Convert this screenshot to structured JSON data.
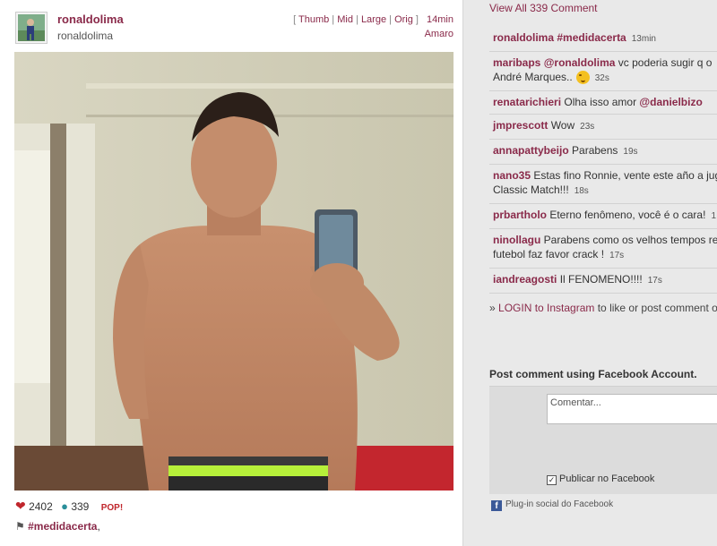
{
  "post": {
    "username": "ronaldolima",
    "fullname": "ronaldolima",
    "sizes": [
      "Thumb",
      "Mid",
      "Large",
      "Orig"
    ],
    "time": "14min",
    "filter": "Amaro",
    "likes": "2402",
    "comments_count": "339",
    "pop_label": "POP!",
    "tags": [
      "#medidacerta"
    ],
    "tag_suffix": ","
  },
  "sidebar": {
    "view_all": "View All 339 Comment",
    "comments": [
      {
        "user": "ronaldolima",
        "text_parts": [
          {
            "t": "#medidacerta",
            "m": true
          }
        ],
        "time": "13min"
      },
      {
        "user": "maribaps",
        "text_parts": [
          {
            "t": "@ronaldolima",
            "m": true
          },
          {
            "t": " vc poderia sugir q o",
            "m": false
          }
        ],
        "line2": "André Marques..",
        "emoji": true,
        "time": "32s"
      },
      {
        "user": "renatarichieri",
        "text_parts": [
          {
            "t": " Olha isso amor ",
            "m": false
          },
          {
            "t": "@danielbizo",
            "m": true
          }
        ],
        "time": ""
      },
      {
        "user": "jmprescott",
        "text_parts": [
          {
            "t": " Wow",
            "m": false
          }
        ],
        "time": "23s"
      },
      {
        "user": "annapattybeijo",
        "text_parts": [
          {
            "t": " Parabens",
            "m": false
          }
        ],
        "time": "19s"
      },
      {
        "user": "nano35",
        "text_parts": [
          {
            "t": " Estas fino Ronnie, vente este año a jug",
            "m": false
          }
        ],
        "line2": "Classic Match!!!",
        "time": "18s"
      },
      {
        "user": "prbartholo",
        "text_parts": [
          {
            "t": " Eterno fenômeno, você é o cara!",
            "m": false
          }
        ],
        "time": "1"
      },
      {
        "user": "ninollagu",
        "text_parts": [
          {
            "t": " Parabens como os velhos tempos re",
            "m": false
          }
        ],
        "line2": "futebol faz favor crack !",
        "time": "17s"
      },
      {
        "user": "iandreagosti",
        "text_parts": [
          {
            "t": " Il FENOMENO!!!!",
            "m": false
          }
        ],
        "time": "17s"
      }
    ],
    "login_prefix": "» ",
    "login_link": "LOGIN to Instagram",
    "login_suffix": " to like or post comment o"
  },
  "facebook": {
    "title": "Post comment using Facebook Account.",
    "placeholder": "Comentar...",
    "publish_label": "Publicar no Facebook",
    "plugin_label": "Plug-in social do Facebook"
  },
  "colors": {
    "accent": "#8a2a4a",
    "heart": "#c0262c",
    "comment_icon": "#2a8f9a",
    "fb_blue": "#3b5998"
  },
  "icons": {
    "like": "heart-icon",
    "comment": "comment-bubble-icon",
    "tag": "tag-icon",
    "facebook": "facebook-icon"
  }
}
